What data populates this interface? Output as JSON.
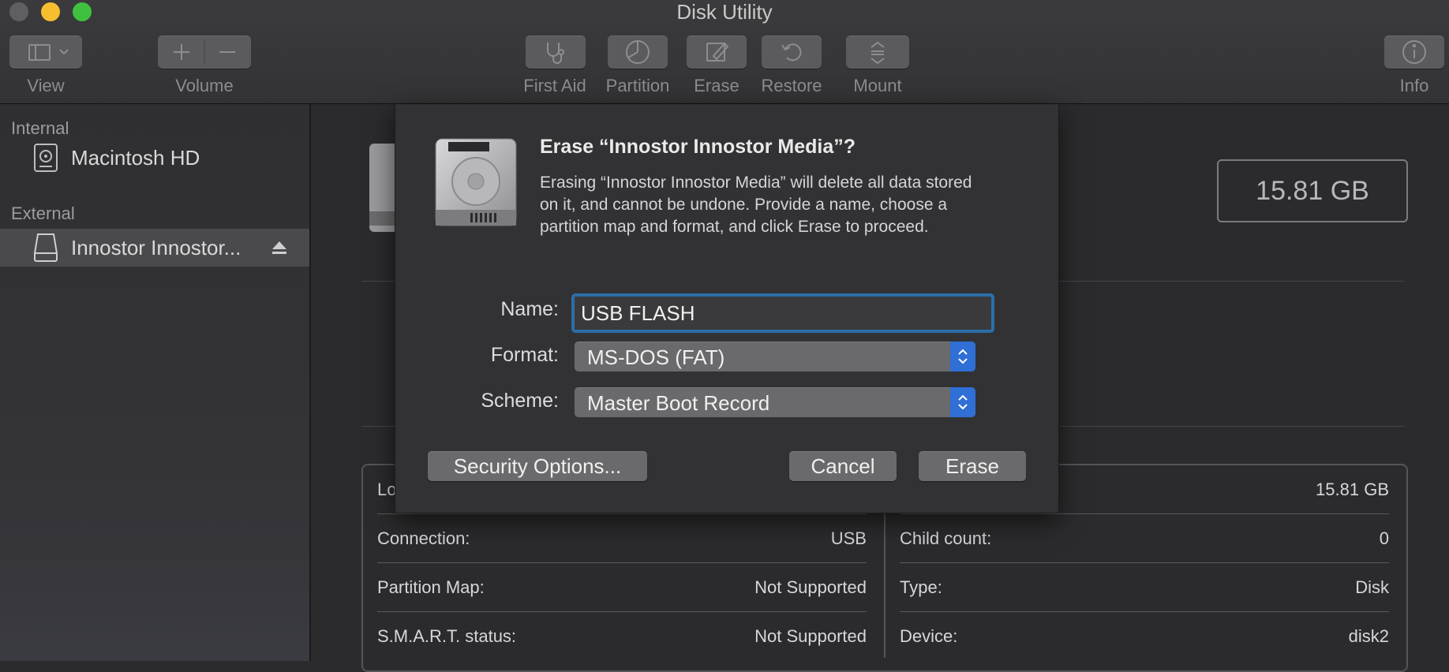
{
  "window": {
    "title": "Disk Utility"
  },
  "toolbar": {
    "view_label": "View",
    "volume_label": "Volume",
    "first_aid_label": "First Aid",
    "partition_label": "Partition",
    "erase_label": "Erase",
    "restore_label": "Restore",
    "mount_label": "Mount",
    "info_label": "Info"
  },
  "sidebar": {
    "internal_header": "Internal",
    "external_header": "External",
    "items": [
      {
        "label": "Macintosh HD",
        "icon": "internal-disk-icon"
      },
      {
        "label": "Innostor Innostor...",
        "icon": "external-disk-icon",
        "selected": true
      }
    ]
  },
  "main": {
    "capacity": "15.81 GB",
    "info_rows_left": [
      {
        "key": "Lo",
        "value": ""
      },
      {
        "key": "Connection:",
        "value": "USB"
      },
      {
        "key": "Partition Map:",
        "value": "Not Supported"
      },
      {
        "key": "S.M.A.R.T. status:",
        "value": "Not Supported"
      }
    ],
    "info_rows_right": [
      {
        "key": "",
        "value": "15.81 GB"
      },
      {
        "key": "Child count:",
        "value": "0"
      },
      {
        "key": "Type:",
        "value": "Disk"
      },
      {
        "key": "Device:",
        "value": "disk2"
      }
    ]
  },
  "dialog": {
    "title": "Erase “Innostor Innostor Media”?",
    "body": "Erasing “Innostor Innostor Media” will delete all data stored on it, and cannot be undone. Provide a name, choose a partition map and format, and click Erase to proceed.",
    "name_label": "Name:",
    "name_value": "USB FLASH",
    "format_label": "Format:",
    "format_value": "MS-DOS (FAT)",
    "scheme_label": "Scheme:",
    "scheme_value": "Master Boot Record",
    "security_button": "Security Options...",
    "cancel_button": "Cancel",
    "erase_button": "Erase"
  },
  "colors": {
    "accent": "#2f6fd6",
    "focus_ring": "#2b6ea8",
    "traffic_close": "#5f5f61",
    "traffic_minimize": "#f5bf2f",
    "traffic_zoom": "#3fc13f"
  }
}
